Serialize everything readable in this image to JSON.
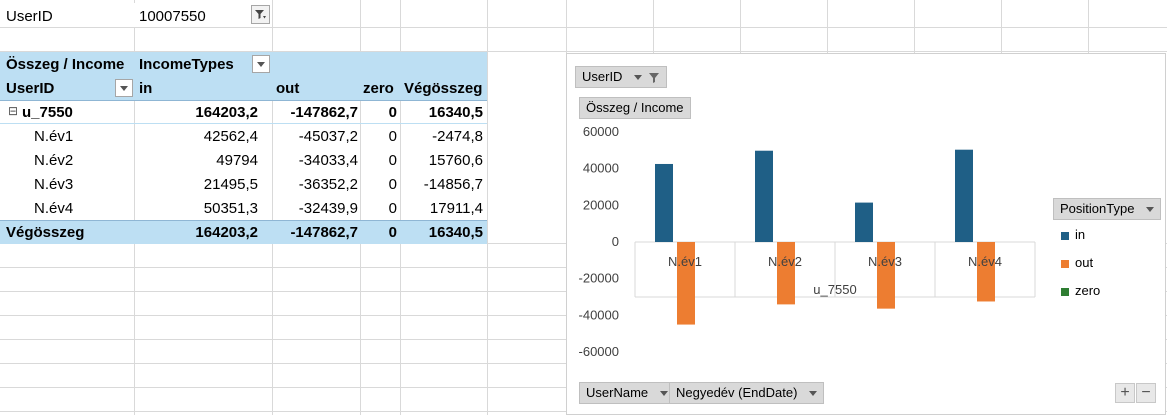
{
  "report_filter": {
    "label": "UserID",
    "value": "10007550"
  },
  "pivot": {
    "value_field": "Összeg / Income",
    "column_field": "IncomeTypes",
    "row_field": "UserID",
    "columns": [
      "in",
      "out",
      "zero",
      "Végösszeg"
    ],
    "group": {
      "label": "u_7550",
      "collapse_glyph": "⊟",
      "values": [
        "164203,2",
        "-147862,7",
        "0",
        "16340,5"
      ]
    },
    "rows": [
      {
        "label": "N.év1",
        "values": [
          "42562,4",
          "-45037,2",
          "0",
          "-2474,8"
        ]
      },
      {
        "label": "N.év2",
        "values": [
          "49794",
          "-34033,4",
          "0",
          "15760,6"
        ]
      },
      {
        "label": "N.év3",
        "values": [
          "21495,5",
          "-36352,2",
          "0",
          "-14856,7"
        ]
      },
      {
        "label": "N.év4",
        "values": [
          "50351,3",
          "-32439,9",
          "0",
          "17911,4"
        ]
      }
    ],
    "total": {
      "label": "Végösszeg",
      "values": [
        "164203,2",
        "-147862,7",
        "0",
        "16340,5"
      ]
    }
  },
  "chart_panel": {
    "filter_button": "UserID",
    "value_button": "Összeg / Income",
    "axis_buttons": [
      "UserName",
      "Negyedév  (EndDate)"
    ],
    "legend_button": "PositionType",
    "zoom_in": "+",
    "zoom_out": "−"
  },
  "chart_data": {
    "type": "bar",
    "categories": [
      "N.év1",
      "N.év2",
      "N.év3",
      "N.év4"
    ],
    "group_label": "u_7550",
    "series": [
      {
        "name": "in",
        "color": "#1f5f86",
        "values": [
          42562.4,
          49794,
          21495.5,
          50351.3
        ]
      },
      {
        "name": "out",
        "color": "#ed7d31",
        "values": [
          -45037.2,
          -34033.4,
          -36352.2,
          -32439.9
        ]
      },
      {
        "name": "zero",
        "color": "#2e7d32",
        "values": [
          0,
          0,
          0,
          0
        ]
      }
    ],
    "ylim": [
      -60000,
      60000
    ],
    "yticks": [
      60000,
      40000,
      20000,
      0,
      -20000,
      -40000,
      -60000
    ],
    "grid": false,
    "legend_position": "right"
  }
}
